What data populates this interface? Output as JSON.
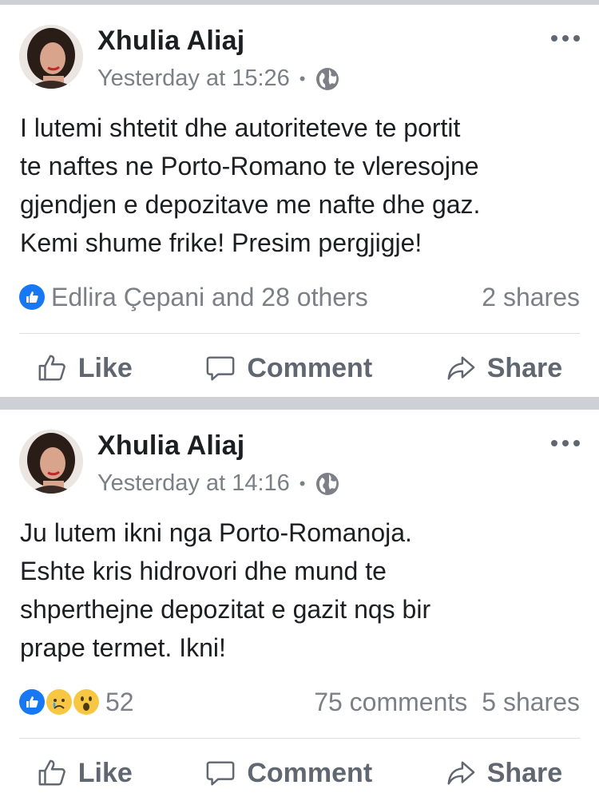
{
  "posts": [
    {
      "author": "Xhulia Aliaj",
      "time": "Yesterday at 15:26",
      "text": "I lutemi shtetit dhe autoriteteve te portit\nte naftes ne Porto-Romano te vleresojne\ngjendjen e depozitave me nafte dhe gaz.\nKemi shume frike! Presim pergjigje!",
      "reactions_text": "Edlira Çepani and 28 others",
      "shares": "2 shares",
      "actions": {
        "like": "Like",
        "comment": "Comment",
        "share": "Share"
      }
    },
    {
      "author": "Xhulia Aliaj",
      "time": "Yesterday at 14:16",
      "text": "Ju lutem ikni nga Porto-Romanoja.\nEshte kris hidrovori dhe mund te\nshperthejne depozitat e gazit nqs bir\nprape termet. Ikni!",
      "reactions_count": "52",
      "comments": "75 comments",
      "shares": "5 shares",
      "actions": {
        "like": "Like",
        "comment": "Comment",
        "share": "Share"
      }
    }
  ],
  "colors": {
    "like_blue": "#1877f2",
    "meta_gray": "#7c7f85",
    "separator": "#cdd0d4"
  },
  "icons": [
    "globe-icon",
    "more-icon",
    "like-reaction-icon",
    "sad-reaction-icon",
    "wow-reaction-icon",
    "thumbs-up-icon",
    "comment-icon",
    "share-arrow-icon"
  ]
}
